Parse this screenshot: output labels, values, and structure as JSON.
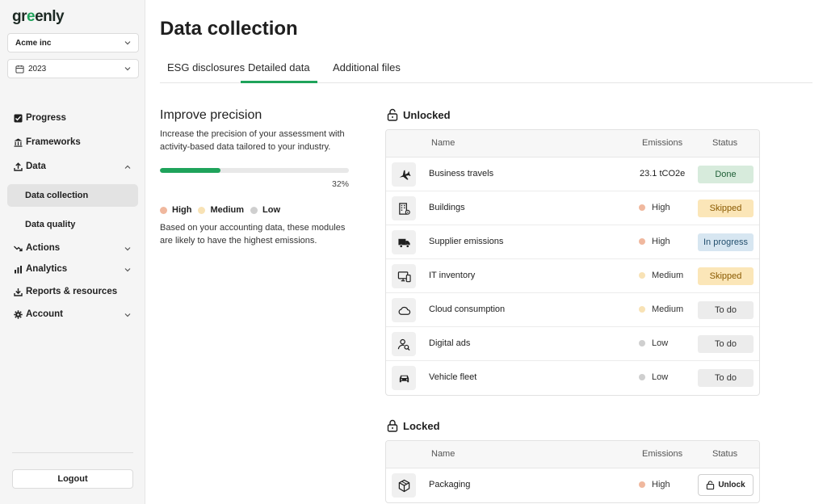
{
  "app": {
    "logo": "greenly",
    "logo_prefix": "gr",
    "logo_mark": "e",
    "logo_suffix": "enly"
  },
  "sidebar": {
    "company_select": "Acme inc",
    "year_select": "2023",
    "nav": {
      "progress": "Progress",
      "frameworks": "Frameworks",
      "data": "Data",
      "data_collection": "Data collection",
      "data_quality": "Data quality",
      "actions": "Actions",
      "analytics": "Analytics",
      "reports": "Reports & resources",
      "account": "Account"
    },
    "logout": "Logout"
  },
  "header": {
    "title": "Data collection",
    "tabs": [
      "ESG disclosures",
      "Detailed data",
      "Additional files"
    ],
    "active_tab": 1
  },
  "precision": {
    "title": "Improve precision",
    "description": "Increase the precision of your assessment with activity-based data tailored to your industry.",
    "progress_percent": 32,
    "progress_label": "32%",
    "legend": {
      "high": "High",
      "medium": "Medium",
      "low": "Low"
    },
    "note": "Based on your accounting data, these modules are likely to have the highest emissions."
  },
  "colors": {
    "accent": "#1fa35b",
    "high": "#f0b89e",
    "medium": "#f8e2b5",
    "low": "#cfcfcf",
    "done_bg": "#d7ebdc",
    "skipped_bg": "#fbe6b8",
    "in_progress_bg": "#d7e6f1",
    "todo_bg": "#ececec"
  },
  "unlocked": {
    "title": "Unlocked",
    "columns": {
      "name": "Name",
      "emissions": "Emissions",
      "status": "Status"
    },
    "rows": [
      {
        "icon": "plane-icon",
        "name": "Business travels",
        "emissions": "23.1 tCO2e",
        "level": null,
        "status": "Done"
      },
      {
        "icon": "building-icon",
        "name": "Buildings",
        "emissions": "High",
        "level": "high",
        "status": "Skipped"
      },
      {
        "icon": "truck-icon",
        "name": "Supplier emissions",
        "emissions": "High",
        "level": "high",
        "status": "In progress"
      },
      {
        "icon": "devices-icon",
        "name": "IT inventory",
        "emissions": "Medium",
        "level": "medium",
        "status": "Skipped"
      },
      {
        "icon": "cloud-icon",
        "name": "Cloud consumption",
        "emissions": "Medium",
        "level": "medium",
        "status": "To do"
      },
      {
        "icon": "ads-icon",
        "name": "Digital ads",
        "emissions": "Low",
        "level": "low",
        "status": "To do"
      },
      {
        "icon": "car-icon",
        "name": "Vehicle fleet",
        "emissions": "Low",
        "level": "low",
        "status": "To do"
      }
    ]
  },
  "locked": {
    "title": "Locked",
    "columns": {
      "name": "Name",
      "emissions": "Emissions",
      "status": "Status"
    },
    "rows": [
      {
        "icon": "box-icon",
        "name": "Packaging",
        "emissions": "High",
        "level": "high",
        "action": "Unlock"
      }
    ]
  }
}
